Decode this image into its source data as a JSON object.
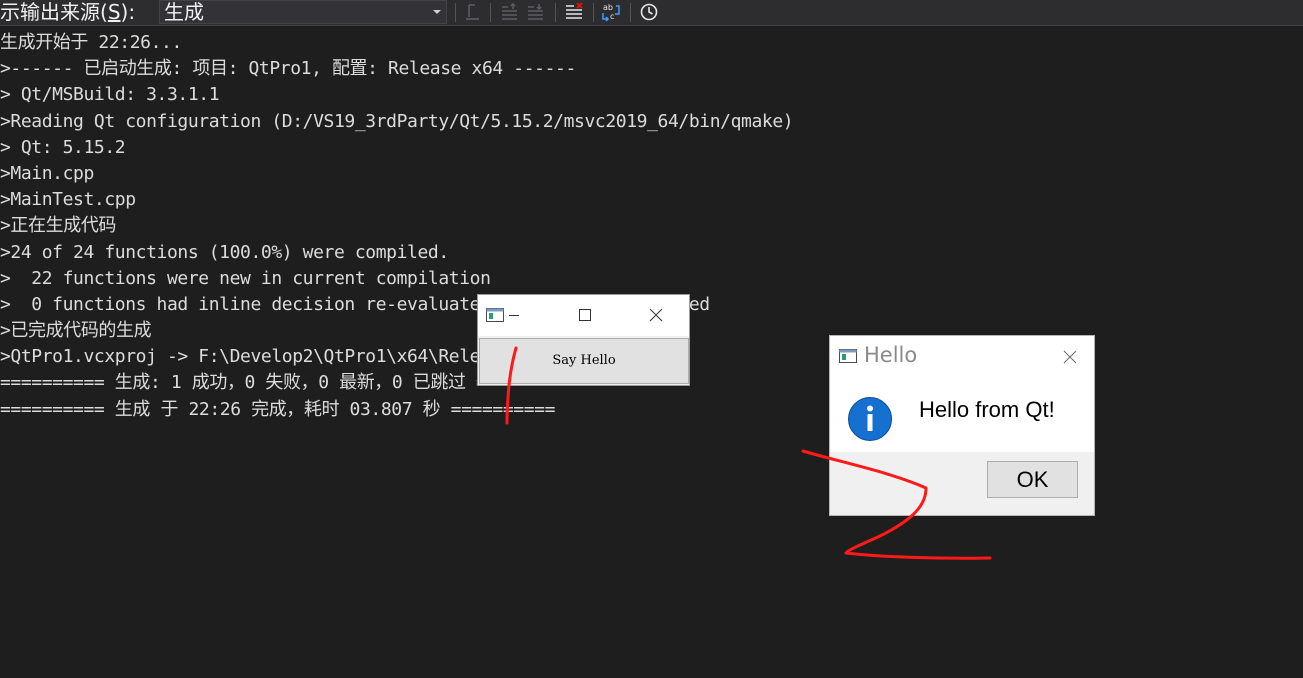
{
  "toolbar": {
    "show_output_label_prefix": "示输出来源(",
    "show_output_label_key": "S",
    "show_output_label_suffix": "):",
    "source_selected": "生成",
    "icons": [
      "find-message-icon",
      "previous-message-icon",
      "next-message-icon",
      "clear-all-icon",
      "word-wrap-icon",
      "clock-icon"
    ]
  },
  "output": {
    "lines": [
      "生成开始于 22:26...",
      ">------ 已启动生成: 项目: QtPro1, 配置: Release x64 ------",
      "> Qt/MSBuild: 3.3.1.1",
      ">Reading Qt configuration (D:/VS19_3rdParty/Qt/5.15.2/msvc2019_64/bin/qmake)",
      "> Qt: 5.15.2",
      ">Main.cpp",
      ">MainTest.cpp",
      ">正在生成代码",
      ">24 of 24 functions (100.0%) were compiled.",
      ">  22 functions were new in current compilation",
      ">  0 functions had inline decision re-evaluated but remain unchanged",
      ">已完成代码的生成",
      ">QtPro1.vcxproj -> F:\\Develop2\\QtPro1\\x64\\Release\\QtPro1.exe",
      "========== 生成: 1 成功，0 失败，0 最新，0 已跳过 ==========",
      "========== 生成 于 22:26 完成，耗时 03.807 秒 =========="
    ]
  },
  "qt_window": {
    "button_label": "Say Hello"
  },
  "message_box": {
    "title": "Hello",
    "text": "Hello from Qt!",
    "ok_label": "OK",
    "icon": "information-icon"
  },
  "colors": {
    "editor_bg": "#1e1e1e",
    "text": "#dcdcdc",
    "annotation": "#ff1a1a",
    "info_blue": "#1570d0"
  }
}
